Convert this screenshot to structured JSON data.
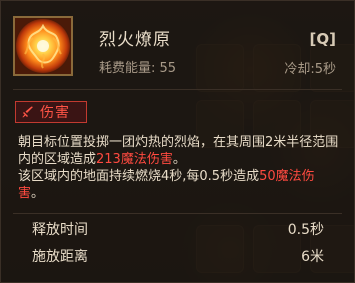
{
  "skill": {
    "title": "烈火燎原",
    "hotkey": "[Q]",
    "energy": "耗费能量: 55",
    "cooldown": "冷却:5秒",
    "icon": "fire-burst-icon"
  },
  "tag": {
    "label": "伤害",
    "icon": "sword-icon",
    "color": "#ff5446"
  },
  "description": {
    "line1": "朝目标位置投掷一团灼热的烈焰，在其周围2米半径范围内的区域造成",
    "dmg1": "213魔法伤害",
    "line1_end": "。",
    "line2": "该区域内的地面持续燃烧4秒,每0.5秒造成",
    "dmg2": "50魔法伤害",
    "line2_end": "。"
  },
  "stats": [
    {
      "label": "释放时间",
      "value": "0.5秒"
    },
    {
      "label": "施放距离",
      "value": "6米"
    }
  ],
  "colors": {
    "damage_text": "#ff4a40",
    "frame_gold": "#8a6a3a"
  }
}
